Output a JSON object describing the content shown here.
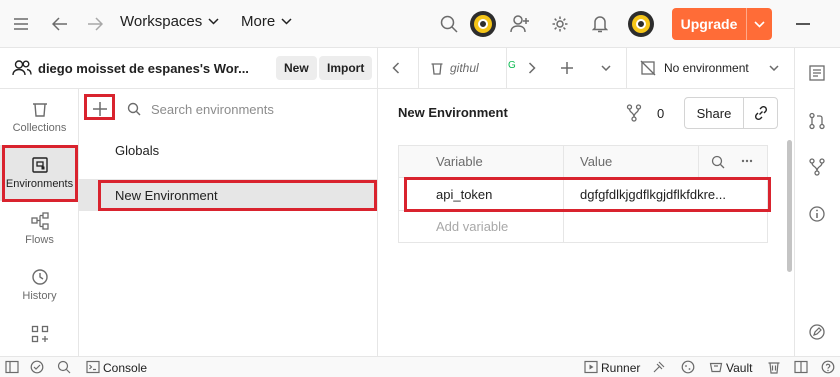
{
  "topbar": {
    "workspaces_label": "Workspaces",
    "more_label": "More",
    "upgrade_label": "Upgrade"
  },
  "workspace": {
    "name": "diego moisset de espanes's Wor...",
    "new_label": "New",
    "import_label": "Import"
  },
  "sidebar": {
    "items": [
      {
        "label": "Collections",
        "icon": "trash-can-icon"
      },
      {
        "label": "Environments",
        "icon": "environment-icon"
      },
      {
        "label": "Flows",
        "icon": "flows-icon"
      },
      {
        "label": "History",
        "icon": "history-icon"
      },
      {
        "label": "",
        "icon": "apps-grid-icon"
      }
    ]
  },
  "envlist": {
    "search_placeholder": "Search environments",
    "items": [
      "Globals",
      "New Environment"
    ]
  },
  "tabs": {
    "tab1_label": "githul",
    "env_selector": "No environment"
  },
  "main": {
    "title": "New Environment",
    "fork_count": "0",
    "share_label": "Share",
    "table": {
      "col_variable": "Variable",
      "col_value": "Value",
      "rows": [
        {
          "variable": "api_token",
          "value": "dgfgfdlkjgdflkgjdflkfdkre..."
        }
      ],
      "add_placeholder": "Add variable"
    }
  },
  "statusbar": {
    "console_label": "Console",
    "runner_label": "Runner",
    "vault_label": "Vault"
  },
  "colors": {
    "accent": "#ff6c37",
    "annotation": "#d9232e"
  }
}
